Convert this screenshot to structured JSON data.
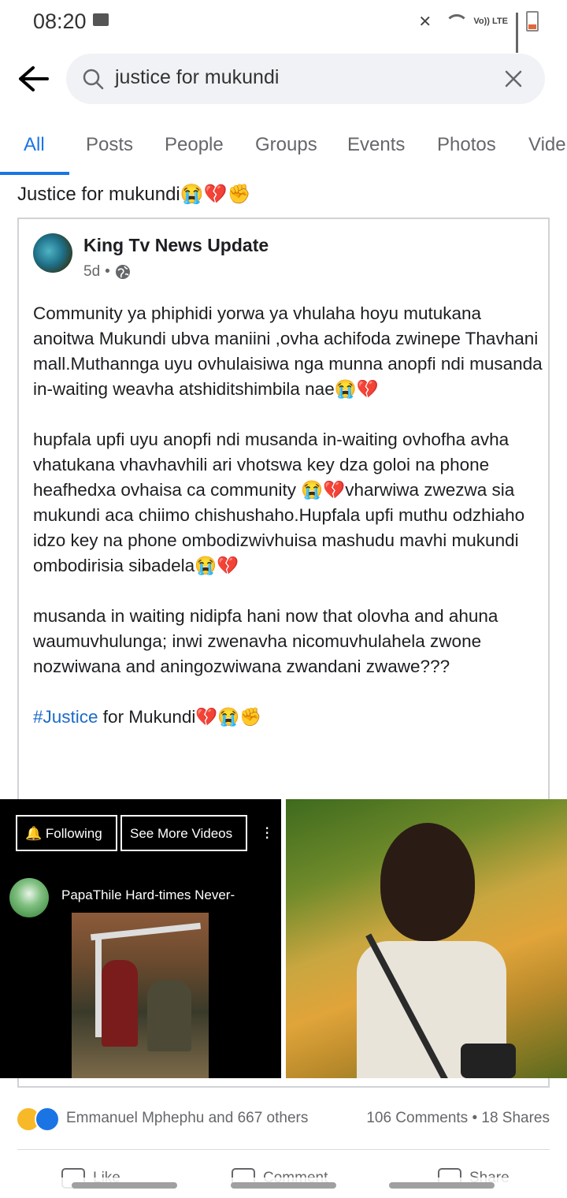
{
  "status_bar": {
    "time": "08:20",
    "network": "Vo)) LTE"
  },
  "search": {
    "query": "justice for mukundi"
  },
  "tabs": [
    {
      "label": "All",
      "active": true
    },
    {
      "label": "Posts",
      "active": false
    },
    {
      "label": "People",
      "active": false
    },
    {
      "label": "Groups",
      "active": false
    },
    {
      "label": "Events",
      "active": false
    },
    {
      "label": "Photos",
      "active": false
    },
    {
      "label": "Vide",
      "active": false
    }
  ],
  "result_header": "Justice for mukundi😭💔✊",
  "post": {
    "author": "King Tv News Update",
    "time": "5d",
    "paragraphs": [
      "Community ya phiphidi yorwa ya vhulaha hoyu mutukana anoitwa Mukundi ubva maniini ,ovha achifoda zwinepe Thavhani mall.Muthannga uyu ovhulaisiwa nga munna anopfi ndi musanda in-waiting weavha atshiditshimbila nae😭💔",
      "hupfala upfi uyu anopfi ndi musanda in-waiting ovhofha avha vhatukana vhavhavhili ari vhotswa key dza goloi na phone heafhedxa ovhaisa ca community 😭💔vharwiwa zwezwa sia mukundi aca chiimo chishushaho.Hupfala upfi muthu odzhiaho idzo key na phone ombodizwivhuisa mashudu mavhi mukundi ombodirisia sibadela😭💔",
      "musanda in waiting nidipfa hani now that olovha and ahuna waumuvhulunga; inwi zwenavha nicomuvhulahela zwone nozwiwana and aningozwiwana zwandani zwawe???"
    ],
    "hashtag": "#Justice",
    "last_line_rest": " for Mukundi💔😭✊",
    "video_image": {
      "following_label": "Following",
      "see_more_label": "See More Videos",
      "channel_name": "PapaThile Hard-times Never-"
    },
    "reactions": {
      "names": "Emmanuel Mphephu and 667 others",
      "counts": "106 Comments • 18 Shares"
    },
    "actions": [
      "Like",
      "Comment",
      "Share"
    ]
  }
}
